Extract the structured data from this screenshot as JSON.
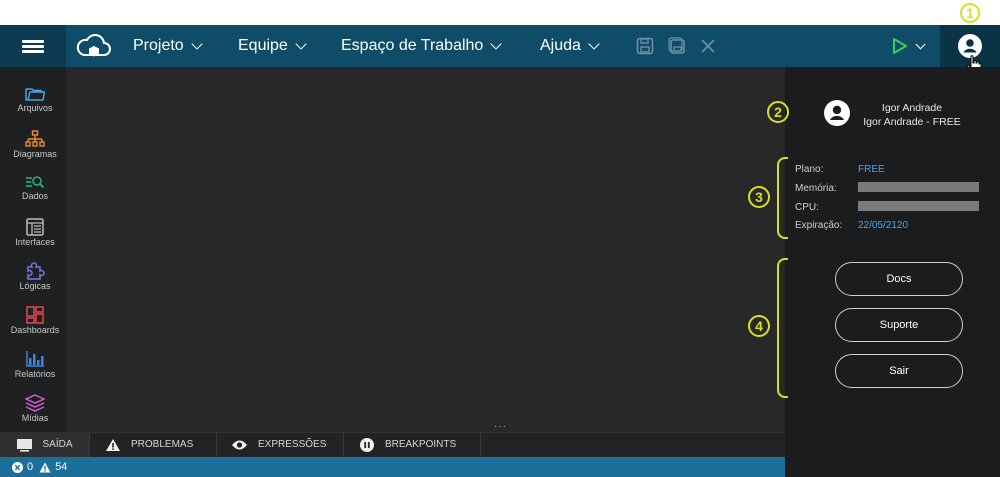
{
  "menu": {
    "items": [
      {
        "label": "Projeto"
      },
      {
        "label": "Equipe"
      },
      {
        "label": "Espaço de Trabalho"
      },
      {
        "label": "Ajuda"
      }
    ]
  },
  "sidebar": {
    "items": [
      {
        "label": "Arquivos",
        "icon": "folder-icon",
        "color": "#4aa3e8"
      },
      {
        "label": "Diagramas",
        "icon": "diagram-icon",
        "color": "#f08a24"
      },
      {
        "label": "Dados",
        "icon": "data-search-icon",
        "color": "#2bb673"
      },
      {
        "label": "Interfaces",
        "icon": "interface-icon",
        "color": "#bcbcbc"
      },
      {
        "label": "Lógicas",
        "icon": "puzzle-icon",
        "color": "#6c7bea"
      },
      {
        "label": "Dashboards",
        "icon": "dashboard-icon",
        "color": "#e6484b"
      },
      {
        "label": "Relatórios",
        "icon": "report-icon",
        "color": "#3a86e0"
      },
      {
        "label": "Mídias",
        "icon": "layers-icon",
        "color": "#d35ad8"
      }
    ]
  },
  "bottom_tabs": [
    {
      "label": "SAÍDA",
      "icon": "monitor-icon"
    },
    {
      "label": "PROBLEMAS",
      "icon": "warning-icon"
    },
    {
      "label": "EXPRESSÕES",
      "icon": "eye-icon"
    },
    {
      "label": "BREAKPOINTS",
      "icon": "pause-icon"
    }
  ],
  "status": {
    "errors": "0",
    "warnings": "54"
  },
  "user": {
    "name": "Igor Andrade",
    "plan_line": "Igor Andrade - FREE"
  },
  "info": {
    "plan_label": "Plano:",
    "plan_value": "FREE",
    "memory_label": "Memória:",
    "cpu_label": "CPU:",
    "expiry_label": "Expiração:",
    "expiry_value": "22/05/2120"
  },
  "buttons": {
    "docs": "Docs",
    "support": "Suporte",
    "logout": "Sair"
  },
  "annotations": [
    "1",
    "2",
    "3",
    "4"
  ],
  "colors": {
    "topbar": "#0f4c68",
    "accent": "#d7e021",
    "status_bar": "#1b6f9a",
    "value_blue": "#4aa3e8"
  }
}
